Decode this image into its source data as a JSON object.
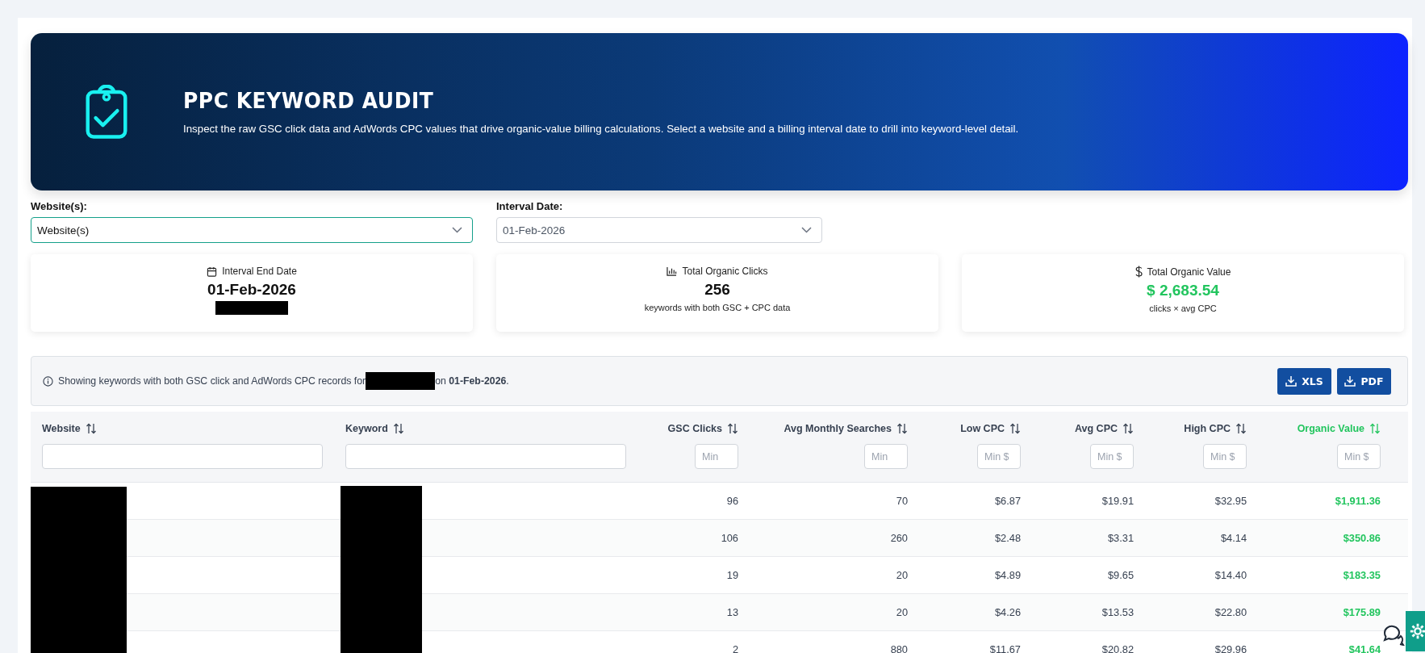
{
  "header": {
    "title": "PPC KEYWORD AUDIT",
    "description": "Inspect the raw GSC click data and AdWords CPC values that drive organic-value billing calculations. Select a website and a billing interval date to drill into keyword-level detail."
  },
  "filters": [
    {
      "label": "Website(s):",
      "value": "Website(s)",
      "focused": true
    },
    {
      "label": "Interval Date:",
      "value": "01-Feb-2026",
      "focused": false
    }
  ],
  "stats": [
    {
      "kind": "calendar",
      "label": "Interval End Date",
      "value": "01-Feb-2026",
      "highlight": false,
      "redacted_note": true
    },
    {
      "kind": "bars",
      "label": "Total Organic Clicks",
      "value": "256",
      "note": "keywords with both GSC + CPC data",
      "highlight": false
    },
    {
      "kind": "dollar",
      "label": "Total Organic Value",
      "value": "$ 2,683.54",
      "note": "clicks × avg CPC",
      "highlight": true
    }
  ],
  "info": {
    "before": "Showing keywords with both GSC click and AdWords CPC records for",
    "after": "on **01-Feb-2026**."
  },
  "export_buttons": [
    "XLS",
    "PDF"
  ],
  "table": {
    "columns": [
      {
        "label": "Website",
        "kind": "text",
        "highlight": false
      },
      {
        "label": "Keyword",
        "kind": "text",
        "highlight": false
      },
      {
        "label": "GSC Clicks",
        "kind": "number",
        "placeholder": "Min",
        "highlight": false
      },
      {
        "label": "Avg Monthly Searches",
        "kind": "number",
        "placeholder": "Min",
        "highlight": false
      },
      {
        "label": "Low CPC",
        "kind": "number",
        "placeholder": "Min $",
        "highlight": false
      },
      {
        "label": "Avg CPC",
        "kind": "number",
        "placeholder": "Min $",
        "highlight": false
      },
      {
        "label": "High CPC",
        "kind": "number",
        "placeholder": "Min $",
        "highlight": false
      },
      {
        "label": "Organic Value",
        "kind": "number",
        "placeholder": "Min $",
        "highlight": true
      }
    ],
    "rows": [
      {
        "cells": [
          "",
          "",
          "96",
          "70",
          "$6.87",
          "$19.91",
          "$32.95",
          "$1,911.36"
        ]
      },
      {
        "cells": [
          "",
          "",
          "106",
          "260",
          "$2.48",
          "$3.31",
          "$4.14",
          "$350.86"
        ]
      },
      {
        "cells": [
          "",
          "",
          "19",
          "20",
          "$4.89",
          "$9.65",
          "$14.40",
          "$183.35"
        ]
      },
      {
        "cells": [
          "",
          "",
          "13",
          "20",
          "$4.26",
          "$13.53",
          "$22.80",
          "$175.89"
        ]
      },
      {
        "cells": [
          "",
          "",
          "2",
          "880",
          "$11.67",
          "$20.82",
          "$29.96",
          "$41.64"
        ]
      }
    ]
  }
}
